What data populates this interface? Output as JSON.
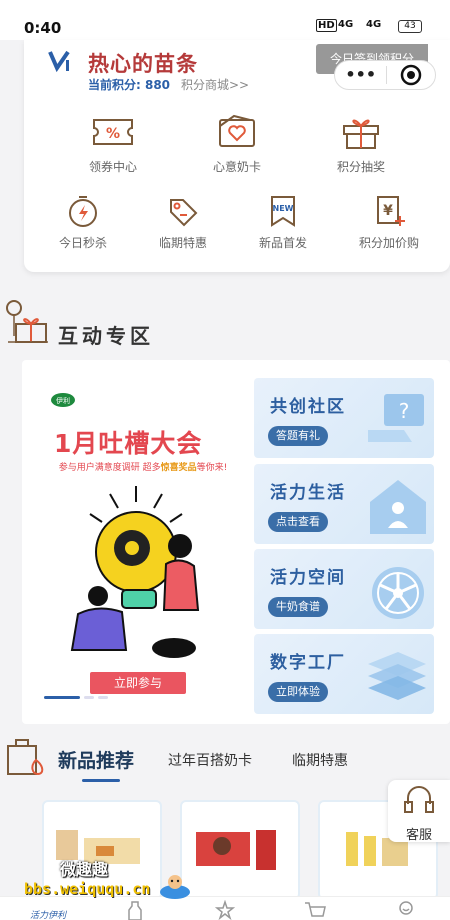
{
  "status_bar": {
    "time": "0:40",
    "hd": "HD",
    "net1": "4G",
    "net2": "4G",
    "battery": "43"
  },
  "header": {
    "user_name": "热心的苗条",
    "points_label": "当前积分: 880",
    "mall_link": "积分商城>>",
    "signin_banner": "今日签到领积分",
    "menu_dots": "•••"
  },
  "quick_menu": [
    {
      "label": "领券中心",
      "icon": "coupon-icon"
    },
    {
      "label": "心意奶卡",
      "icon": "heart-card-icon"
    },
    {
      "label": "积分抽奖",
      "icon": "gift-box-icon"
    },
    {
      "label": "今日秒杀",
      "icon": "flash-timer-icon"
    },
    {
      "label": "临期特惠",
      "icon": "price-tag-icon"
    },
    {
      "label": "新品首发",
      "icon": "new-badge-icon",
      "badge": "NEW"
    },
    {
      "label": "积分加价购",
      "icon": "yuan-plus-icon",
      "symbol": "¥"
    }
  ],
  "interactive_section": {
    "title": "互动专区",
    "banner": {
      "logo": "伊利",
      "title": "1月吐槽大会",
      "subtitle_pre": "参与用户满意度调研 超多",
      "subtitle_em": "惊喜奖品",
      "subtitle_post": "等你来!",
      "button": "立即参与"
    },
    "tiles": [
      {
        "title": "共创社区",
        "button": "答题有礼"
      },
      {
        "title": "活力生活",
        "button": "点击查看"
      },
      {
        "title": "活力空间",
        "button": "牛奶食谱"
      },
      {
        "title": "数字工厂",
        "button": "立即体验"
      }
    ]
  },
  "product_tabs": {
    "active": "新品推荐",
    "tab2": "过年百搭奶卡",
    "tab3": "临期特惠"
  },
  "customer_service": {
    "label": "客服"
  },
  "bottom_nav": {
    "first_label": "活力伊利"
  },
  "watermark": {
    "line1": "微趣趣",
    "line2": "bbs.weiququ.cn"
  },
  "colors": {
    "brand_red": "#b53a3a",
    "brand_blue": "#2b5fa8",
    "banner_red": "#e3474f"
  }
}
